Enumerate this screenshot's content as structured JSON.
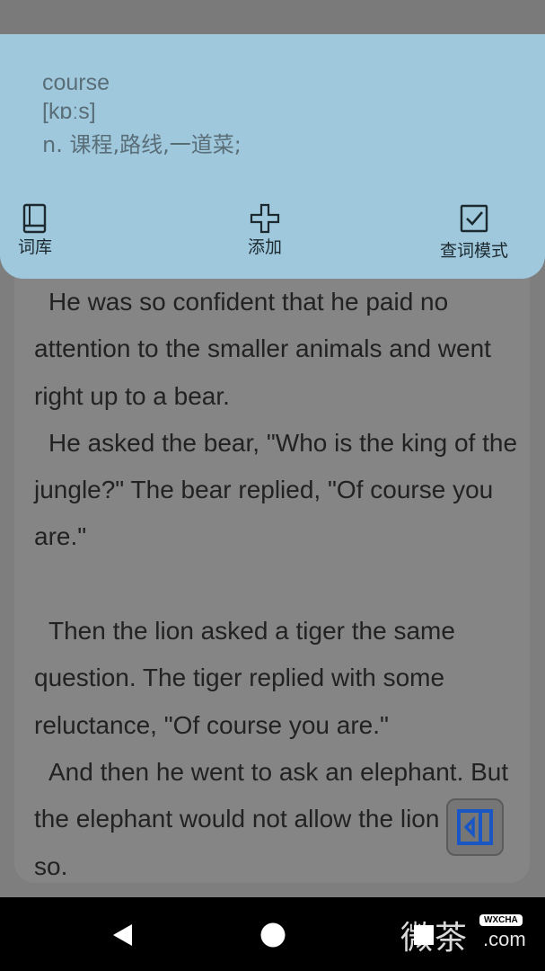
{
  "dictionary": {
    "word": "course",
    "phonetic": "[kɒːs]",
    "meaning": "n. 课程,路线,一道菜;",
    "actions": {
      "vocab_label": "词库",
      "vocab_icon": "book-icon",
      "add_label": "添加",
      "add_icon": "plus-icon",
      "mode_label": "查词模式",
      "mode_icon": "checkbox-icon"
    }
  },
  "reader": {
    "lines": [
      "He was so confident that he paid no attention to the smaller animals and went right up to a bear.",
      "He asked the bear, \"Who is the king of the jungle?\" The bear replied, \"Of course you are.\"",
      "",
      "Then the lion asked a tiger the same question. The tiger replied with some reluctance, \"Of course you are.\"",
      "And then he went to ask an elephant. But the elephant would not allow the lion to do so."
    ]
  },
  "side_toggle": {
    "icon": "collapse-panel-icon",
    "color": "#1a56c4"
  },
  "nav": {
    "back_icon": "back-triangle-icon",
    "home_icon": "home-circle-icon",
    "recent_icon": "recent-square-icon"
  },
  "watermark": {
    "glyphs": "微茶",
    "badge": "WXCHA",
    "domain": ".com"
  },
  "colors": {
    "panel": "#9fc8dd",
    "dim_overlay": "#7e7e7e",
    "nav_bar": "#000000"
  }
}
